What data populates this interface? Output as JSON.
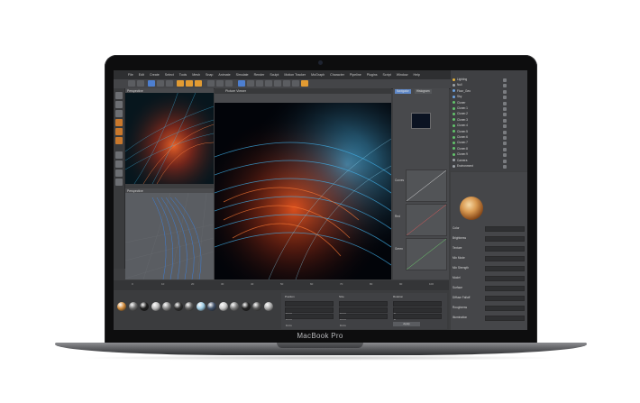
{
  "device": {
    "model_label": "MacBook Pro"
  },
  "app": {
    "menus": [
      "File",
      "Edit",
      "Create",
      "Select",
      "Tools",
      "Mesh",
      "Snap",
      "Animate",
      "Simulate",
      "Render",
      "Sculpt",
      "Motion Tracker",
      "MoGraph",
      "Character",
      "Pipeline",
      "Plugins",
      "Script",
      "Window",
      "Help"
    ],
    "viewport_top_label": "Perspective",
    "viewport_bottom_label": "Perspective",
    "picture_viewer_title": "Picture Viewer",
    "side_tabs": [
      "Navigator",
      "Histogram"
    ],
    "graph_labels": [
      "Curves",
      "Red",
      "Green",
      "Blue"
    ],
    "object_manager_items": [
      {
        "label": "Lighting",
        "color": "#e6b33b"
      },
      {
        "label": "Null",
        "color": "#9ea3a8"
      },
      {
        "label": "Floor_Geo",
        "color": "#6ba1e0"
      },
      {
        "label": "Sky",
        "color": "#6ba1e0"
      },
      {
        "label": "Cloner",
        "color": "#62c36b"
      },
      {
        "label": "Cloner.1",
        "color": "#62c36b"
      },
      {
        "label": "Cloner.2",
        "color": "#62c36b"
      },
      {
        "label": "Cloner.3",
        "color": "#62c36b"
      },
      {
        "label": "Cloner.4",
        "color": "#62c36b"
      },
      {
        "label": "Cloner.5",
        "color": "#62c36b"
      },
      {
        "label": "Cloner.6",
        "color": "#62c36b"
      },
      {
        "label": "Cloner.7",
        "color": "#62c36b"
      },
      {
        "label": "Cloner.8",
        "color": "#62c36b"
      },
      {
        "label": "Cloner.9",
        "color": "#62c36b"
      },
      {
        "label": "Camera",
        "color": "#9ea3a8"
      },
      {
        "label": "Environment",
        "color": "#9ea3a8"
      }
    ],
    "attribute_rows": [
      "Color",
      "Brightness",
      "Texture",
      "Mix Mode",
      "Mix Strength",
      "Model",
      "Surface",
      "Diffuse Falloff",
      "Roughness",
      "Illumination"
    ],
    "timeline_ticks": [
      "0",
      "10",
      "20",
      "30",
      "40",
      "50",
      "60",
      "70",
      "80",
      "90",
      "100"
    ],
    "material_colors": [
      "#d08a3a",
      "#6b6b6b",
      "#1e1e1e",
      "#bbbbbb",
      "#888888",
      "#2f2f2f",
      "#5c5c5c",
      "#9ecbe3",
      "#3f4f67",
      "#c8c8c8",
      "#7a7a7a",
      "#222222",
      "#555555",
      "#aaaaaa"
    ],
    "coord_labels": [
      "Position",
      "Size",
      "Rotation"
    ],
    "coord_values": [
      "0 cm",
      "0 cm",
      "0 cm",
      "0 cm",
      "0 cm",
      "0 cm",
      "0 °",
      "0 °",
      "0 °"
    ],
    "apply_label": "Apply"
  }
}
